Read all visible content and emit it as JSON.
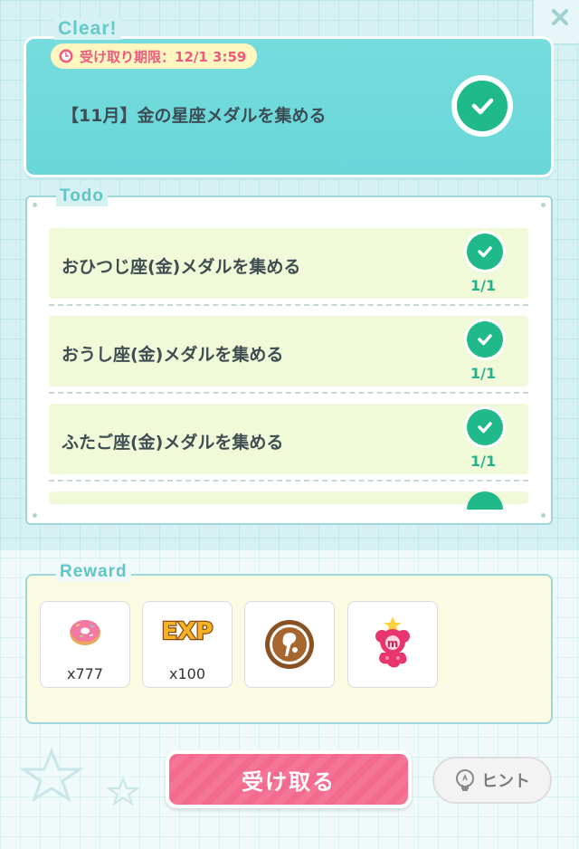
{
  "colors": {
    "accent_teal": "#69d7d9",
    "check_green": "#1fb98a",
    "primary_pink": "#f36a8f",
    "row_green": "#f0fad8",
    "reward_bg": "#fbfbe4"
  },
  "mission": {
    "status_label": "Clear!",
    "deadline": "受け取り期限：12/1 3:59",
    "title": "【11月】金の星座メダルを集める",
    "completed_icon": "check-icon"
  },
  "todo": {
    "section_label": "Todo",
    "items": [
      {
        "label": "おひつじ座(金)メダルを集める",
        "progress": "1/1",
        "done": true
      },
      {
        "label": "おうし座(金)メダルを集める",
        "progress": "1/1",
        "done": true
      },
      {
        "label": "ふたご座(金)メダルを集める",
        "progress": "1/1",
        "done": true
      }
    ]
  },
  "reward": {
    "section_label": "Reward",
    "items": [
      {
        "icon": "donut-icon",
        "quantity": "x777"
      },
      {
        "icon": "exp-icon",
        "icon_text": "EXP",
        "quantity": "x100"
      },
      {
        "icon": "stamp-badge-icon",
        "quantity": ""
      },
      {
        "icon": "character-icon",
        "quantity": ""
      }
    ]
  },
  "actions": {
    "receive_label": "受け取る",
    "hint_label": "ヒント",
    "hint_icon": "lightbulb-icon",
    "close_icon": "close-icon"
  }
}
